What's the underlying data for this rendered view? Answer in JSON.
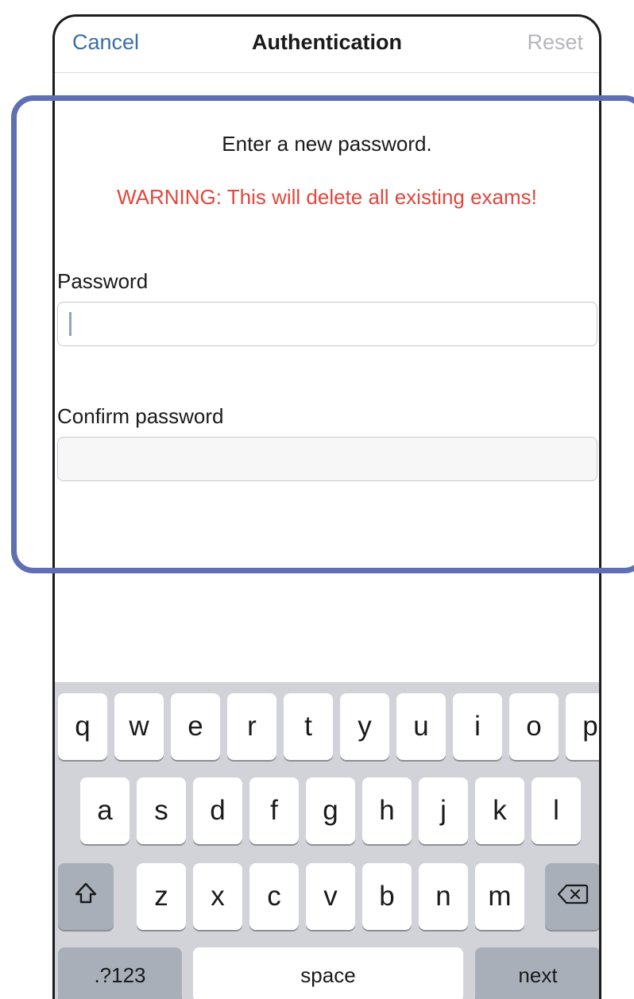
{
  "navbar": {
    "cancel_label": "Cancel",
    "title": "Authentication",
    "reset_label": "Reset"
  },
  "form": {
    "instruction": "Enter a new password.",
    "warning": "WARNING: This will delete all existing exams!",
    "password_label": "Password",
    "confirm_label": "Confirm password",
    "password_value": "",
    "confirm_value": ""
  },
  "keyboard": {
    "row1": [
      "q",
      "w",
      "e",
      "r",
      "t",
      "y",
      "u",
      "i",
      "o",
      "p"
    ],
    "row2": [
      "a",
      "s",
      "d",
      "f",
      "g",
      "h",
      "j",
      "k",
      "l"
    ],
    "row3": [
      "z",
      "x",
      "c",
      "v",
      "b",
      "n",
      "m"
    ],
    "shift_icon": "shift-icon",
    "delete_icon": "backspace-icon",
    "numbers_label": ".?123",
    "space_label": "space",
    "return_label": "next"
  },
  "colors": {
    "link_blue": "#3c6ea6",
    "warning_red": "#e2473e",
    "highlight_border": "#5e6fb4",
    "keyboard_bg": "#d1d3d9"
  }
}
